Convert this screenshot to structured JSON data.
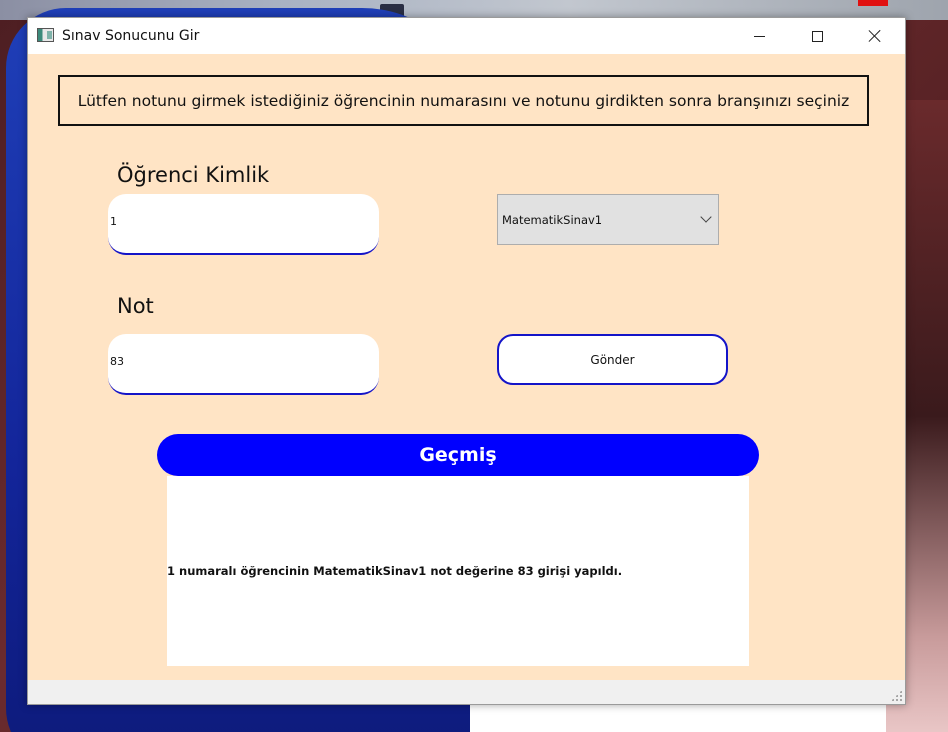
{
  "window": {
    "title": "Sınav Sonucunu Gir"
  },
  "instruction": "Lütfen notunu girmek istediğiniz öğrencinin numarasını ve notunu girdikten sonra branşınızı seçiniz",
  "form": {
    "student_id_label": "Öğrenci Kimlik",
    "student_id_value": "1",
    "grade_label": "Not",
    "grade_value": "83",
    "exam_select_value": "MatematikSinav1",
    "submit_label": "Gönder"
  },
  "history": {
    "title": "Geçmiş",
    "entries": [
      "1 numaralı öğrencinin MatematikSinav1 not değerine 83 girişi yapıldı."
    ]
  },
  "colors": {
    "window_bg": "#ffe4c5",
    "accent_blue": "#0000ff",
    "field_border": "#1414c8"
  }
}
